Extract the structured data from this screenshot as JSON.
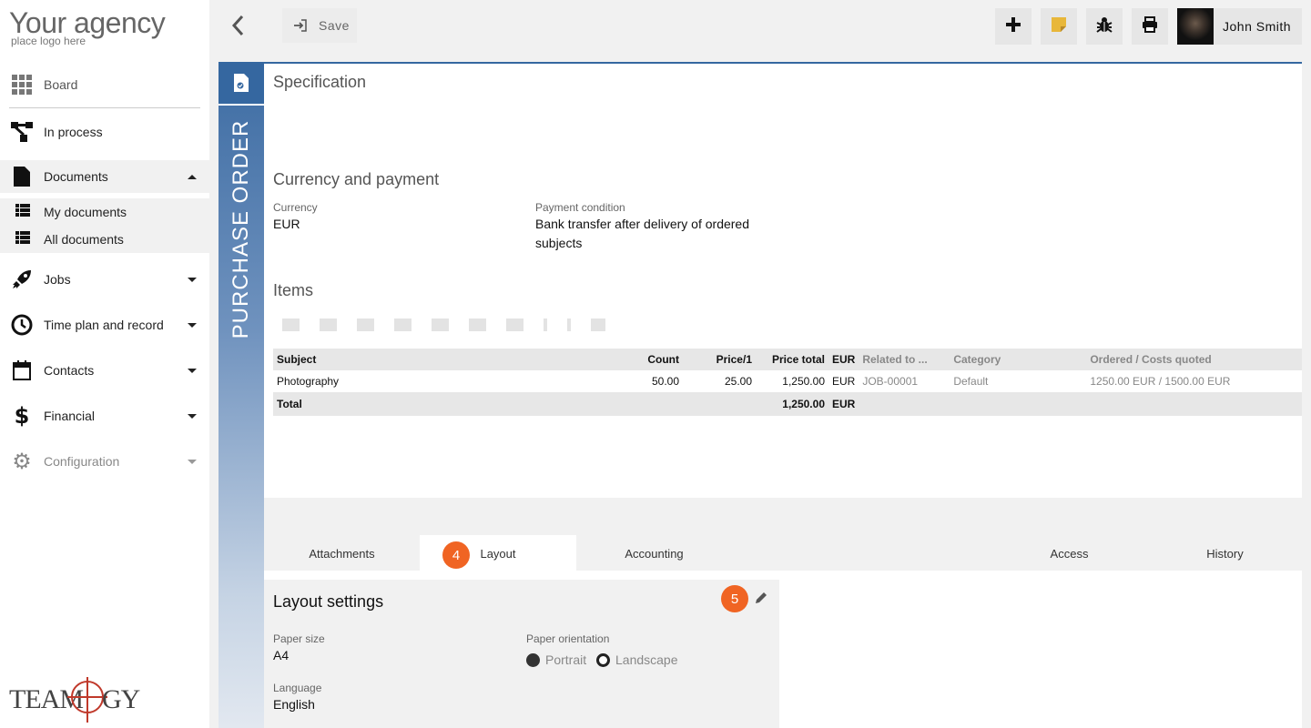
{
  "logo": {
    "title": "Your agency",
    "subtitle": "place logo here",
    "brand": "TEAMOGY"
  },
  "sidebar": {
    "board": "Board",
    "in_process": "In process",
    "documents": "Documents",
    "my_documents": "My documents",
    "all_documents": "All documents",
    "jobs": "Jobs",
    "time_plan": "Time plan and record",
    "contacts": "Contacts",
    "financial": "Financial",
    "configuration": "Configuration"
  },
  "toolbar": {
    "save_label": "Save",
    "user_name": "John Smith"
  },
  "doc": {
    "type_label": "PURCHASE ORDER",
    "specification_title": "Specification",
    "currency_section": "Currency and payment",
    "currency_label": "Currency",
    "currency_value": "EUR",
    "payment_label": "Payment condition",
    "payment_value": "Bank transfer after delivery of ordered subjects",
    "items_title": "Items"
  },
  "items_table": {
    "headers": [
      "Subject",
      "Count",
      "Price/1",
      "Price total",
      "EUR",
      "Related to ...",
      "Category",
      "Ordered / Costs quoted"
    ],
    "row": {
      "subject": "Photography",
      "count": "50.00",
      "price": "25.00",
      "total": "1,250.00",
      "currency": "EUR",
      "related": "JOB-00001",
      "category": "Default",
      "ordered": "1250.00 EUR / 1500.00 EUR"
    },
    "total_row": {
      "label": "Total",
      "total": "1,250.00",
      "currency": "EUR"
    }
  },
  "tabs": {
    "attachments": "Attachments",
    "layout": "Layout",
    "accounting": "Accounting",
    "access": "Access",
    "history": "History"
  },
  "badges": {
    "tab": "4",
    "edit": "5"
  },
  "layout_settings": {
    "title": "Layout settings",
    "paper_size_label": "Paper size",
    "paper_size_value": "A4",
    "orientation_label": "Paper orientation",
    "portrait": "Portrait",
    "landscape": "Landscape",
    "language_label": "Language",
    "language_value": "English"
  },
  "colors": {
    "accent": "#3567a0",
    "badge": "#f06423",
    "note": "#e8b73a"
  }
}
